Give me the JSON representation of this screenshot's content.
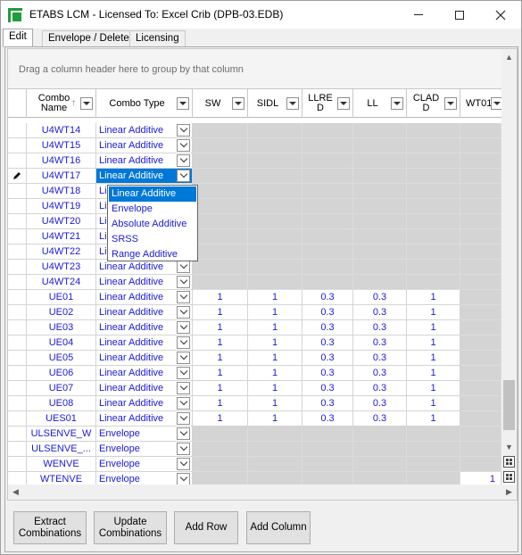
{
  "window": {
    "title": "ETABS LCM  -  Licensed To: Excel Crib (DPB-03.EDB)",
    "controls": {
      "minimize": "minimize-icon",
      "maximize": "maximize-icon",
      "close": "close-icon"
    }
  },
  "tabs": [
    {
      "label": "Edit",
      "active": true
    },
    {
      "label": "Envelope / Delete",
      "active": false
    },
    {
      "label": "Licensing",
      "active": false
    }
  ],
  "grid": {
    "group_prompt": "Drag a column header here to group by that column",
    "columns": {
      "combo_name": "Combo\nName",
      "combo_type": "Combo Type",
      "sw": "SW",
      "sidl": "SIDL",
      "llred": "LLRE\nD",
      "ll": "LL",
      "clad": "CLAD\nD",
      "wt01": "WT01"
    },
    "rows": [
      {
        "name": "U4WT14",
        "type": "Linear Additive",
        "vals": null
      },
      {
        "name": "U4WT15",
        "type": "Linear Additive",
        "vals": null
      },
      {
        "name": "U4WT16",
        "type": "Linear Additive",
        "vals": null
      },
      {
        "name": "U4WT17",
        "type": "Linear Additive",
        "vals": null,
        "editing": true
      },
      {
        "name": "U4WT18",
        "type": "Li",
        "vals": null
      },
      {
        "name": "U4WT19",
        "type": "Li",
        "vals": null
      },
      {
        "name": "U4WT20",
        "type": "Li",
        "vals": null
      },
      {
        "name": "U4WT21",
        "type": "Li",
        "vals": null
      },
      {
        "name": "U4WT22",
        "type": "Li",
        "vals": null
      },
      {
        "name": "U4WT23",
        "type": "Linear Additive",
        "vals": null
      },
      {
        "name": "U4WT24",
        "type": "Linear Additive",
        "vals": null
      },
      {
        "name": "UE01",
        "type": "Linear Additive",
        "vals": [
          "1",
          "1",
          "0.3",
          "0.3",
          "1"
        ]
      },
      {
        "name": "UE02",
        "type": "Linear Additive",
        "vals": [
          "1",
          "1",
          "0.3",
          "0.3",
          "1"
        ]
      },
      {
        "name": "UE03",
        "type": "Linear Additive",
        "vals": [
          "1",
          "1",
          "0.3",
          "0.3",
          "1"
        ]
      },
      {
        "name": "UE04",
        "type": "Linear Additive",
        "vals": [
          "1",
          "1",
          "0.3",
          "0.3",
          "1"
        ]
      },
      {
        "name": "UE05",
        "type": "Linear Additive",
        "vals": [
          "1",
          "1",
          "0.3",
          "0.3",
          "1"
        ]
      },
      {
        "name": "UE06",
        "type": "Linear Additive",
        "vals": [
          "1",
          "1",
          "0.3",
          "0.3",
          "1"
        ]
      },
      {
        "name": "UE07",
        "type": "Linear Additive",
        "vals": [
          "1",
          "1",
          "0.3",
          "0.3",
          "1"
        ]
      },
      {
        "name": "UE08",
        "type": "Linear Additive",
        "vals": [
          "1",
          "1",
          "0.3",
          "0.3",
          "1"
        ]
      },
      {
        "name": "UES01",
        "type": "Linear Additive",
        "vals": [
          "1",
          "1",
          "0.3",
          "0.3",
          "1"
        ]
      },
      {
        "name": "ULSENVE_W",
        "type": "Envelope",
        "vals": null
      },
      {
        "name": "ULSENVE_...",
        "type": "Envelope",
        "vals": null
      },
      {
        "name": "WENVE",
        "type": "Envelope",
        "vals": null
      },
      {
        "name": "WTENVE",
        "type": "Envelope",
        "vals": null,
        "wt01": "1"
      }
    ],
    "dropdown_options": [
      "Linear Additive",
      "Envelope",
      "Absolute Additive",
      "SRSS",
      "Range Additive"
    ],
    "dropdown_selected": "Linear Additive"
  },
  "buttons": {
    "extract": "Extract\nCombinations",
    "update": "Update\nCombinations",
    "add_row": "Add Row",
    "add_column": "Add Column"
  },
  "colors": {
    "link_blue": "#1a1ad8",
    "selection": "#0078d7",
    "readonly_gray": "#d4d4d4"
  }
}
